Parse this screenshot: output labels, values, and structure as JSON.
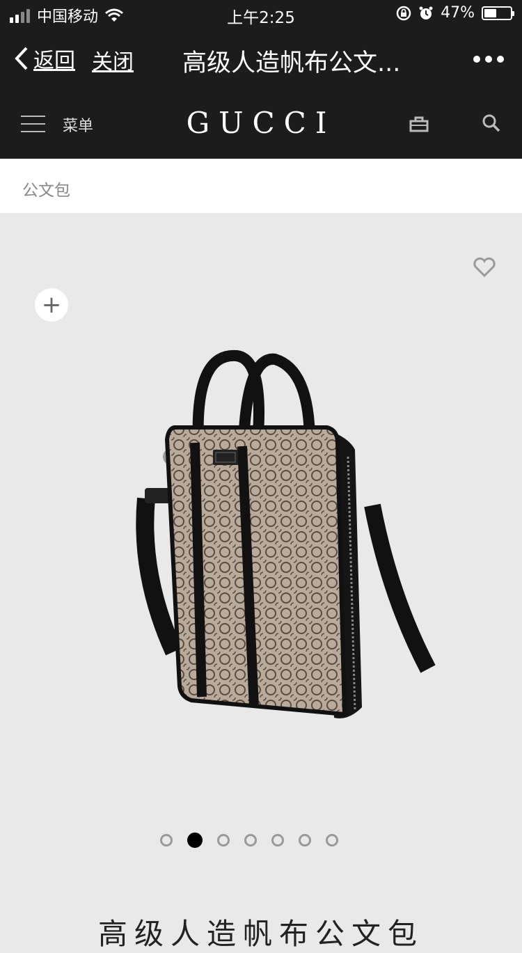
{
  "status_bar": {
    "carrier": "中国移动",
    "time": "上午2:25",
    "battery": "47%",
    "battery_level": 0.47
  },
  "nav": {
    "back_label": "返回",
    "close_label": "关闭",
    "title": "高级人造帆布公文..."
  },
  "header": {
    "menu_label": "菜单",
    "logo": "GUCCI"
  },
  "breadcrumb": {
    "category": "公文包"
  },
  "gallery": {
    "plus_symbol": "+",
    "page_count": 7,
    "active_index": 1
  },
  "product": {
    "title": "高级人造帆布公文包"
  }
}
